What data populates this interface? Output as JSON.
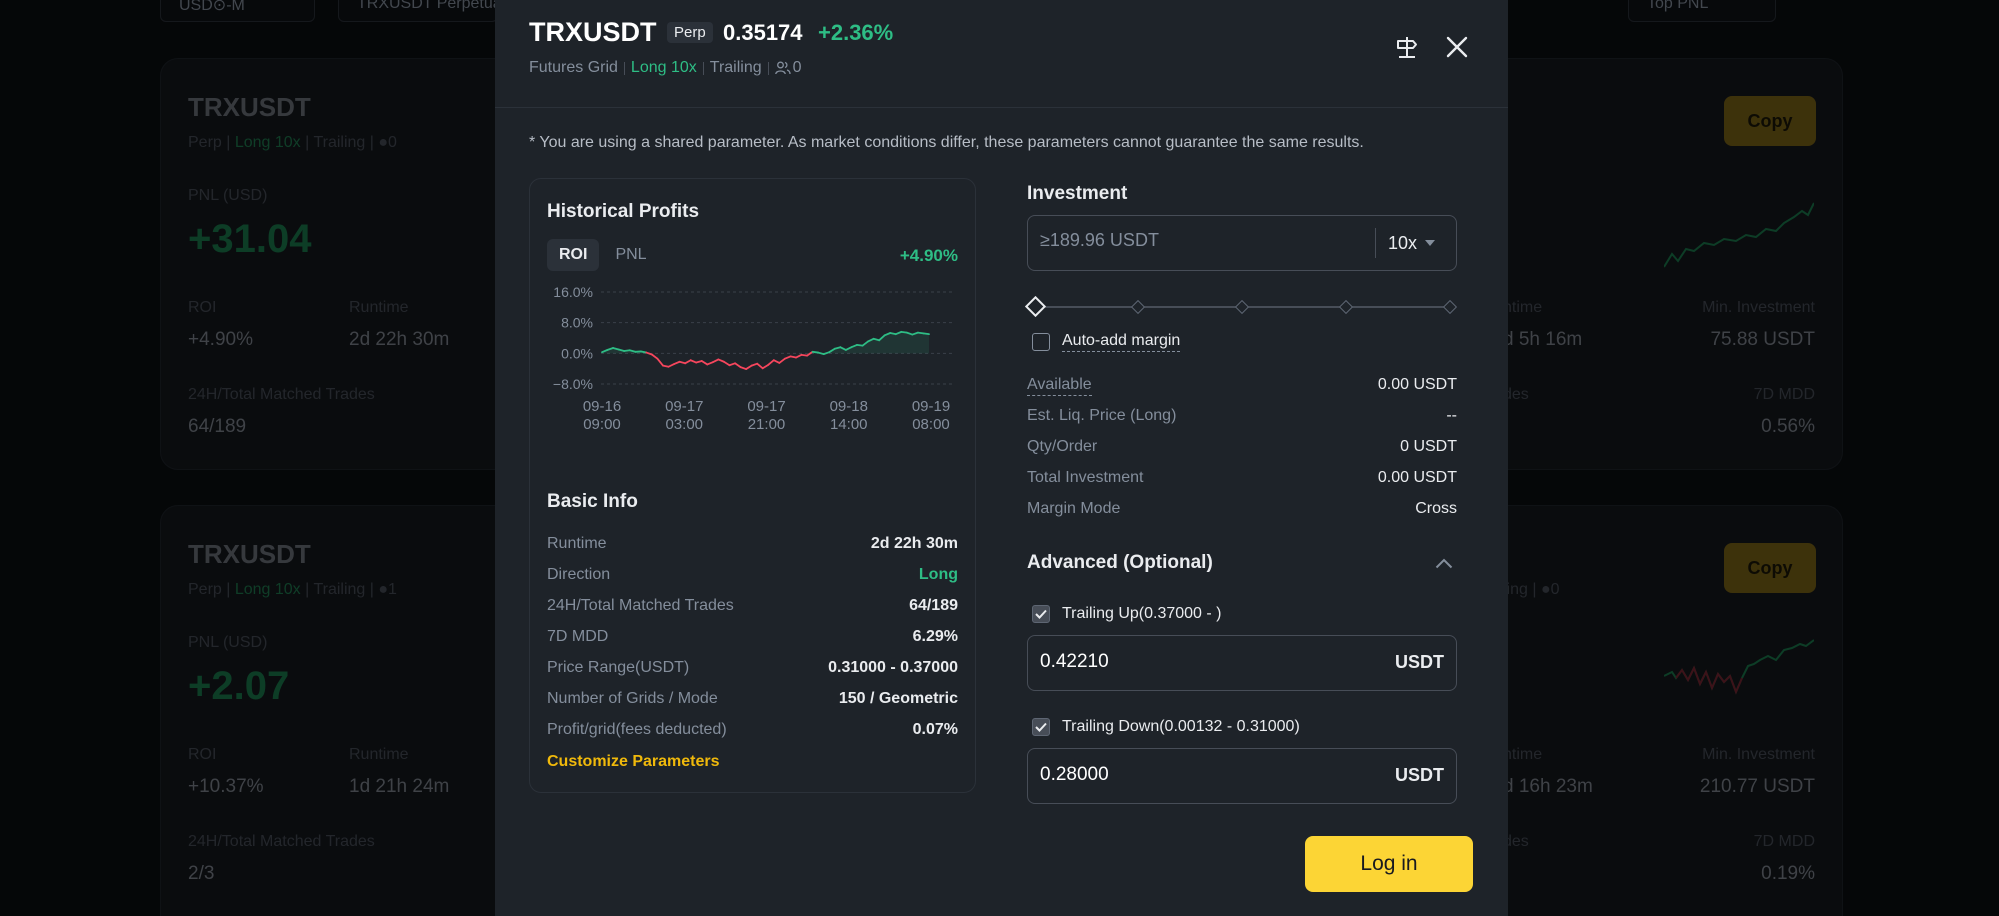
{
  "background": {
    "filters": [
      "USD⊙-M",
      "TRXUSDT Perpetual",
      "Top PNL"
    ],
    "card1": {
      "title": "TRXUSDT",
      "type": "Perp",
      "direction": "Long 10x",
      "mode": "Trailing",
      "users": "0",
      "pnl_label": "PNL (USD)",
      "pnl": "+31.04",
      "roi_label": "ROI",
      "roi": "+4.90%",
      "runtime_label": "Runtime",
      "runtime": "2d 22h 30m",
      "trades_label": "24H/Total Matched Trades",
      "trades": "64/189"
    },
    "card2": {
      "title": "TRXUSDT",
      "type": "Perp",
      "direction": "Long 10x",
      "mode": "Trailing",
      "users": "1",
      "pnl_label": "PNL (USD)",
      "pnl": "+2.07",
      "roi_label": "ROI",
      "roi": "+10.37%",
      "runtime_label": "Runtime",
      "runtime": "1d 21h 24m",
      "trades_label": "24H/Total Matched Trades",
      "trades": "2/3"
    },
    "card3": {
      "copy": "Copy",
      "runtime_label": "ntime",
      "runtime": "d 5h 16m",
      "min_inv_label": "Min. Investment",
      "min_inv": "75.88 USDT",
      "trades_label": "des",
      "mdd_label": "7D MDD",
      "mdd": "0.56%"
    },
    "card4": {
      "copy": "Copy",
      "mode": "ling",
      "users": "0",
      "runtime_label": "ntime",
      "runtime": "d 16h 23m",
      "min_inv_label": "Min. Investment",
      "min_inv": "210.77 USDT",
      "trades_label": "des",
      "mdd_label": "7D MDD",
      "mdd": "0.19%"
    }
  },
  "modal": {
    "symbol": "TRXUSDT",
    "badge": "Perp",
    "price": "0.35174",
    "change": "+2.36%",
    "meta": {
      "strategy": "Futures Grid",
      "direction": "Long 10x",
      "mode": "Trailing",
      "users": "0"
    },
    "notice": "* You are using a shared parameter. As market conditions differ, these parameters cannot guarantee the same results.",
    "history": {
      "title": "Historical Profits",
      "tabs": [
        "ROI",
        "PNL"
      ],
      "roi_value": "+4.90%"
    },
    "basic_info": {
      "title": "Basic Info",
      "rows": [
        {
          "k": "Runtime",
          "v": "2d 22h 30m"
        },
        {
          "k": "Direction",
          "v": "Long"
        },
        {
          "k": "24H/Total Matched Trades",
          "v": "64/189"
        },
        {
          "k": "7D MDD",
          "v": "6.29%"
        },
        {
          "k": "Price Range(USDT)",
          "v": "0.31000 - 0.37000"
        },
        {
          "k": "Number of Grids / Mode",
          "v": "150 / Geometric"
        },
        {
          "k": "Profit/grid(fees deducted)",
          "v": "0.07%"
        }
      ],
      "customize": "Customize Parameters"
    },
    "investment": {
      "label": "Investment",
      "placeholder": "≥189.96 USDT",
      "leverage": "10x",
      "slider_value": 0,
      "auto_margin": "Auto-add margin",
      "auto_margin_checked": false
    },
    "summary": [
      {
        "k": "Available",
        "v": "0.00 USDT"
      },
      {
        "k": "Est. Liq. Price (Long)",
        "v": "--"
      },
      {
        "k": "Qty/Order",
        "v": "0 USDT"
      },
      {
        "k": "Total Investment",
        "v": "0.00 USDT"
      },
      {
        "k": "Margin Mode",
        "v": "Cross"
      }
    ],
    "advanced": {
      "title": "Advanced (Optional)",
      "trailing_up": {
        "label": "Trailing Up(0.37000 - )",
        "checked": true,
        "value": "0.42210",
        "unit": "USDT"
      },
      "trailing_down": {
        "label": "Trailing Down(0.00132 - 0.31000)",
        "checked": true,
        "value": "0.28000",
        "unit": "USDT"
      }
    },
    "login": "Log in"
  },
  "chart_data": {
    "type": "line",
    "ylim": [
      -8,
      16
    ],
    "yticks": [
      "16.0%",
      "8.0%",
      "0.0%",
      "−8.0%"
    ],
    "ytick_values": [
      16,
      8,
      0,
      -8
    ],
    "xticks": [
      [
        "09-16",
        "09:00"
      ],
      [
        "09-17",
        "03:00"
      ],
      [
        "09-17",
        "21:00"
      ],
      [
        "09-18",
        "14:00"
      ],
      [
        "09-19",
        "08:00"
      ]
    ],
    "positive_color": "#2ebd85",
    "negative_color": "#f6465d",
    "values": [
      0.3,
      0.9,
      1.4,
      1.0,
      0.6,
      0.8,
      0.4,
      0.5,
      0.2,
      -0.3,
      -1.4,
      -3.2,
      -3.5,
      -2.8,
      -2.2,
      -2.6,
      -1.8,
      -2.4,
      -2.0,
      -2.9,
      -2.3,
      -1.6,
      -2.2,
      -3.1,
      -2.6,
      -3.6,
      -4.1,
      -3.2,
      -2.7,
      -3.9,
      -3.0,
      -1.8,
      -2.5,
      -1.4,
      -0.8,
      -1.1,
      -0.4,
      -0.6,
      0.4,
      0.2,
      -0.2,
      0.3,
      1.2,
      1.6,
      0.9,
      1.6,
      2.2,
      2.0,
      3.1,
      3.8,
      3.4,
      4.7,
      5.3,
      5.0,
      5.6,
      5.4,
      4.9,
      5.4,
      5.2,
      5.0
    ]
  },
  "colors": {
    "accent": "#fcd535",
    "up": "#2ebd85",
    "down": "#f6465d",
    "link": "#f0b90b"
  }
}
